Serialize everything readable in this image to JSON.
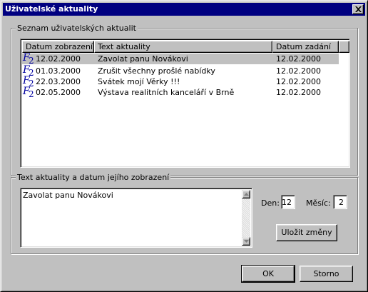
{
  "window": {
    "title": "Uživatelské aktuality"
  },
  "list_group": {
    "legend": "Seznam uživatelských aktualit",
    "columns": [
      "Datum zobrazení +",
      "Text aktuality",
      "Datum zadání"
    ],
    "rows": [
      {
        "shown": "12.02.2000",
        "text": "Zavolat panu Novákovi",
        "entered": "12.02.2000",
        "selected": true
      },
      {
        "shown": "01.03.2000",
        "text": "Zrušit všechny prošlé nabídky",
        "entered": "12.02.2000",
        "selected": false
      },
      {
        "shown": "22.03.2000",
        "text": "Svátek mojí Věrky !!!",
        "entered": "12.02.2000",
        "selected": false
      },
      {
        "shown": "02.05.2000",
        "text": "Výstava realitních kanceláří v Brně",
        "entered": "12.02.2000",
        "selected": false
      }
    ],
    "row_icon": "F2-calendar-icon"
  },
  "edit_group": {
    "legend": "Text aktuality a datum jejího zobrazení",
    "text_value": "Zavolat panu Novákovi",
    "day_label": "Den:",
    "day_value": "12",
    "month_label": "Měsíc:",
    "month_value": "2",
    "save_button": "Uložit změny"
  },
  "footer": {
    "ok_button": "OK",
    "cancel_button": "Storno"
  }
}
